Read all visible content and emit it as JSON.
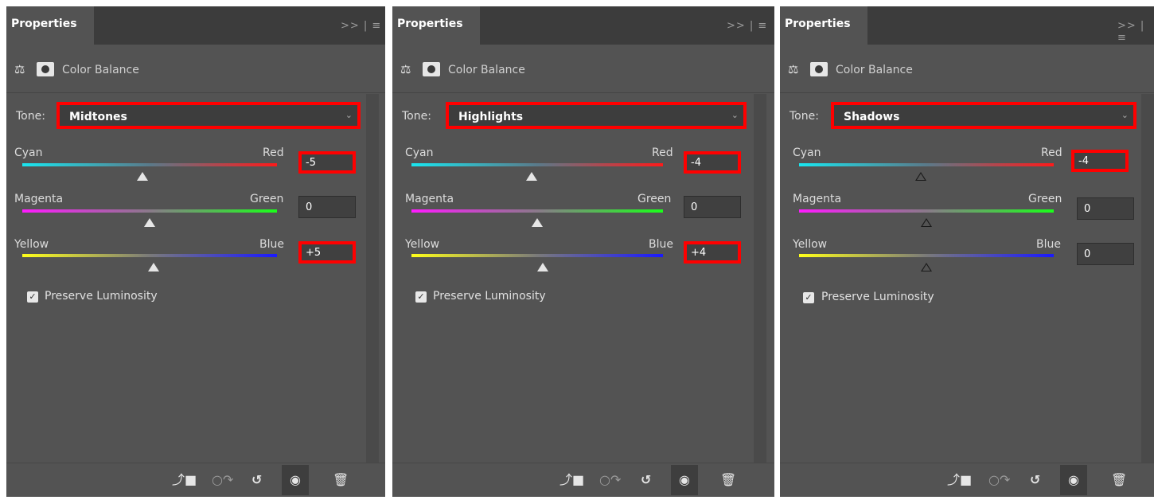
{
  "panels": [
    {
      "tab": "Properties",
      "adjustment_title": "Color Balance",
      "tone_label": "Tone:",
      "tone": "Midtones",
      "sliders": [
        {
          "left": "Cyan",
          "right": "Red",
          "value": "-5",
          "highlighted": true
        },
        {
          "left": "Magenta",
          "right": "Green",
          "value": "0",
          "highlighted": false
        },
        {
          "left": "Yellow",
          "right": "Blue",
          "value": "+5",
          "highlighted": true
        }
      ],
      "preserve_luminosity": "Preserve Luminosity"
    },
    {
      "tab": "Properties",
      "adjustment_title": "Color Balance",
      "tone_label": "Tone:",
      "tone": "Highlights",
      "sliders": [
        {
          "left": "Cyan",
          "right": "Red",
          "value": "-4",
          "highlighted": true
        },
        {
          "left": "Magenta",
          "right": "Green",
          "value": "0",
          "highlighted": false
        },
        {
          "left": "Yellow",
          "right": "Blue",
          "value": "+4",
          "highlighted": true
        }
      ],
      "preserve_luminosity": "Preserve Luminosity"
    },
    {
      "tab": "Properties",
      "adjustment_title": "Color Balance",
      "tone_label": "Tone:",
      "tone": "Shadows",
      "sliders": [
        {
          "left": "Cyan",
          "right": "Red",
          "value": "-4",
          "highlighted": true
        },
        {
          "left": "Magenta",
          "right": "Green",
          "value": "0",
          "highlighted": false
        },
        {
          "left": "Yellow",
          "right": "Blue",
          "value": "0",
          "highlighted": false
        }
      ],
      "preserve_luminosity": "Preserve Luminosity"
    }
  ],
  "icons": {
    "panel_menu": "double-chevron-menu-icon",
    "adjustment": "balance-scale-icon",
    "mask": "layer-mask-icon",
    "footer": [
      "clip-to-layer-icon",
      "view-previous-state-icon",
      "reset-icon",
      "visibility-eye-icon",
      "trash-icon"
    ]
  },
  "colors": {
    "panel_bg": "#535353",
    "tab_bar_bg": "#3c3c3c",
    "highlight_border": "#ff0000"
  }
}
